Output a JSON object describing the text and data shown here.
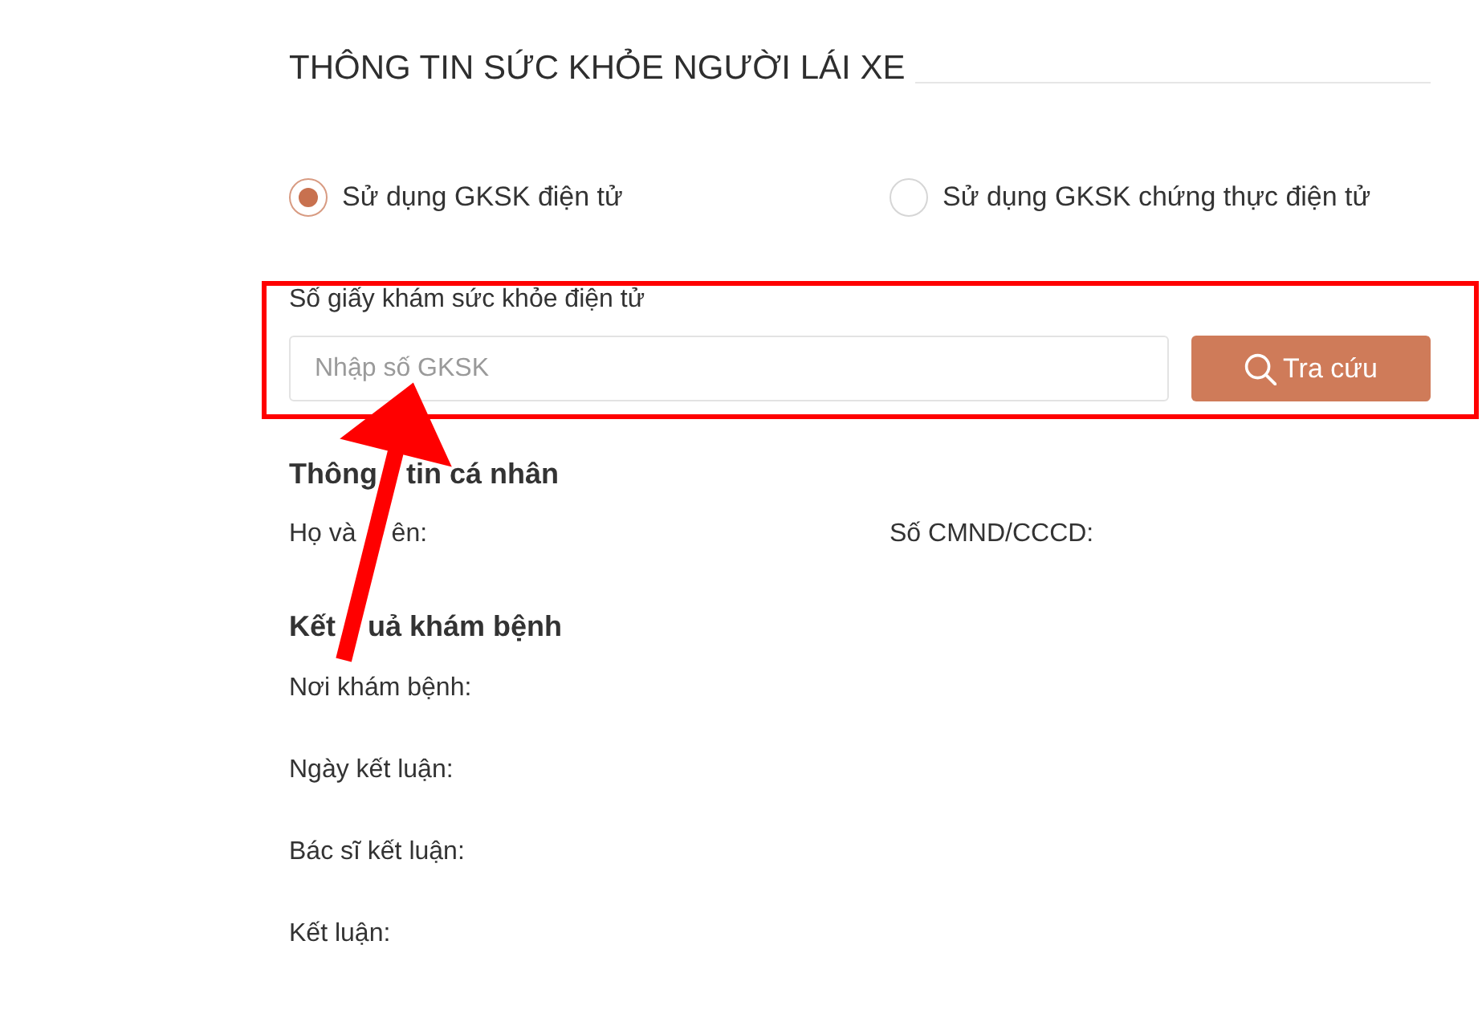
{
  "section_title": "THÔNG TIN SỨC KHỎE NGƯỜI LÁI XE",
  "options": [
    {
      "label": "Sử dụng GKSK điện tử",
      "selected": true
    },
    {
      "label": "Sử dụng GKSK chứng thực điện tử",
      "selected": false
    }
  ],
  "lookup": {
    "highlighted": true,
    "pointed_at": true,
    "label": "Số giấy khám sức khỏe điện tử",
    "field": {
      "placeholder": "Nhập số GKSK"
    },
    "button": "Tra cứu"
  },
  "personal_info": {
    "title_parts": [
      "Thông",
      "tin cá nhân"
    ],
    "fields": [
      {
        "parts": [
          "Họ và",
          "ên:"
        ]
      },
      {
        "parts": [
          "Số CMND/CCCD:"
        ]
      }
    ]
  },
  "exam_result": {
    "title_parts": [
      "Kết",
      "uả khám bệnh"
    ],
    "fields": [
      {
        "parts": [
          "Nơi khám bệnh:"
        ]
      },
      {
        "parts": [
          "Ngày kết luận:"
        ]
      },
      {
        "parts": [
          "Bác sĩ kết luận:"
        ]
      },
      {
        "parts": [
          "Kết luận:"
        ]
      }
    ]
  }
}
